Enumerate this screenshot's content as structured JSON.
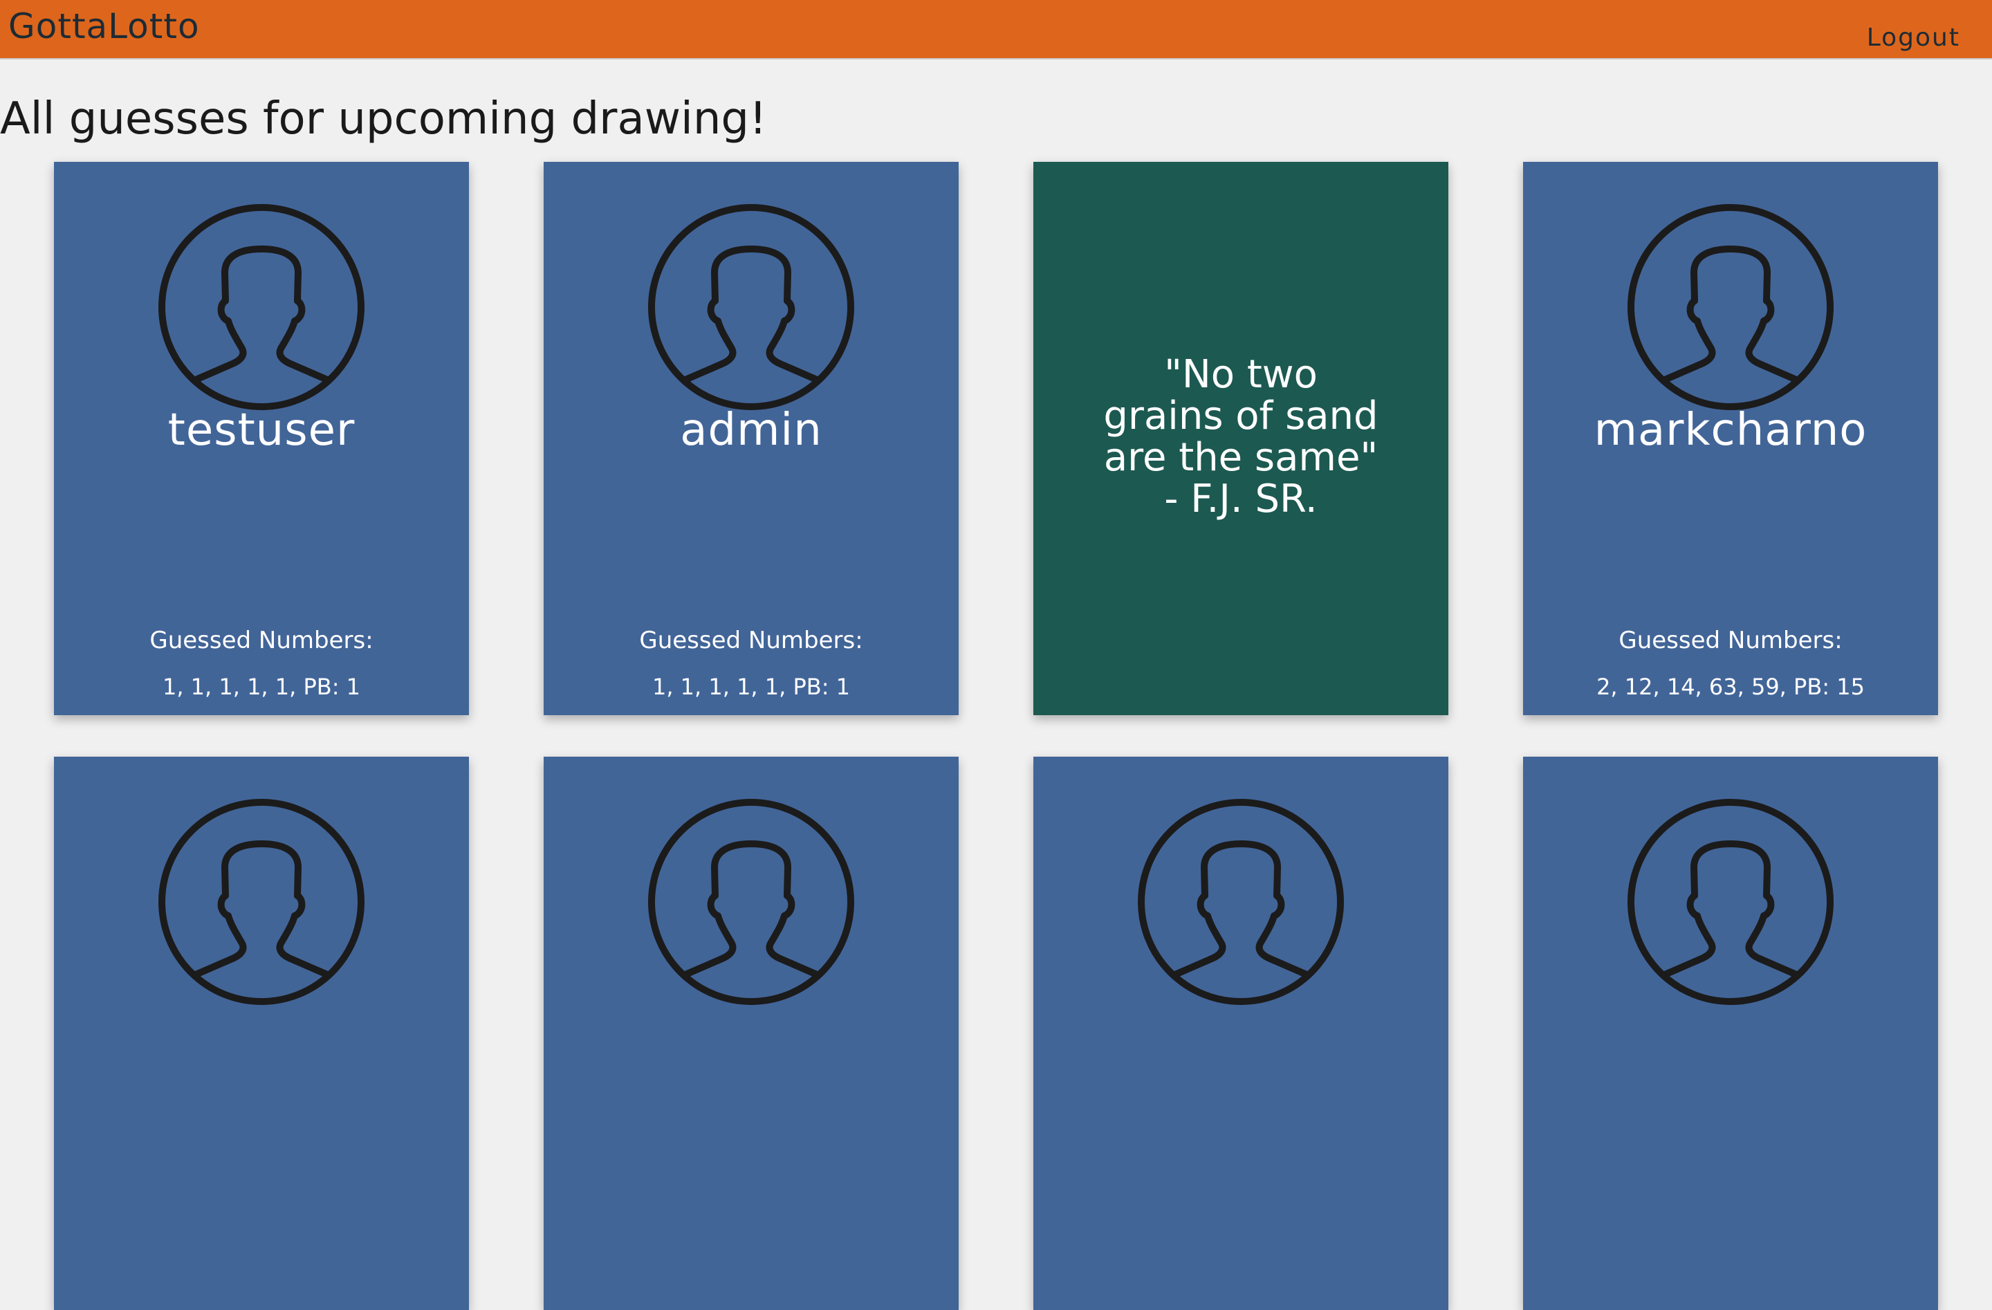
{
  "nav": {
    "brand": "GottaLotto",
    "logout_label": "Logout"
  },
  "page": {
    "heading": "All guesses for upcoming drawing!"
  },
  "cards": [
    {
      "type": "user",
      "username": "testuser",
      "guess_label": "Guessed Numbers:",
      "guess_values": "1, 1, 1, 1, 1, PB: 1"
    },
    {
      "type": "user",
      "username": "admin",
      "guess_label": "Guessed Numbers:",
      "guess_values": "1, 1, 1, 1, 1, PB: 1"
    },
    {
      "type": "quote",
      "quote": "\"No two\ngrains of sand\nare the same\"\n- F.J. SR."
    },
    {
      "type": "user",
      "username": "markcharno",
      "guess_label": "Guessed Numbers:",
      "guess_values": "2, 12, 14, 63, 59, PB: 15"
    },
    {
      "type": "user"
    },
    {
      "type": "user"
    },
    {
      "type": "user"
    },
    {
      "type": "user"
    }
  ],
  "icons": {
    "avatar": "user-silhouette-icon"
  },
  "colors": {
    "navbar": "#dd661c",
    "card_user": "#426598",
    "card_quote": "#1c5951",
    "background": "#f0f0f0"
  }
}
